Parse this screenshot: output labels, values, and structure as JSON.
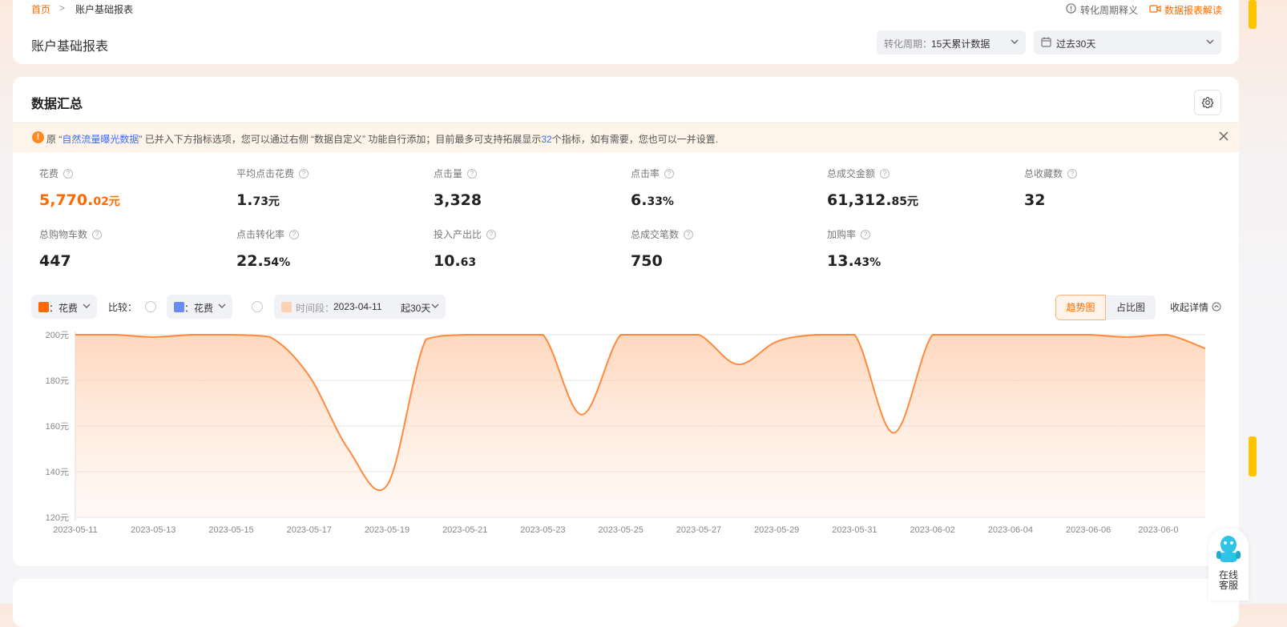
{
  "breadcrumb": {
    "home": "首页",
    "separator": ">",
    "current": "账户基础报表"
  },
  "page_title": "账户基础报表",
  "header_links": {
    "conversion_help": "转化周期释义",
    "report_guide": "数据报表解读"
  },
  "filters": {
    "conversion_period_label": "转化周期：",
    "conversion_period_value": "15天累计数据",
    "date_range_value": "过去30天"
  },
  "summary": {
    "title": "数据汇总",
    "notice": {
      "prefix": "原 “",
      "link": "自然流量曝光数据",
      "middle": "” 已并入下方指标选项，您可以通过右侧 “数据自定义” 功能自行添加；目前最多可支持拓展显示",
      "count": "32",
      "suffix": "个指标，如有需要，您也可以一并设置."
    },
    "metrics": [
      {
        "label": "花费",
        "main": "5,770.",
        "small": "02元"
      },
      {
        "label": "平均点击花费",
        "main": "1.",
        "small": "73元"
      },
      {
        "label": "点击量",
        "main": "3,328",
        "small": ""
      },
      {
        "label": "点击率",
        "main": "6.",
        "small": "33%"
      },
      {
        "label": "总成交金额",
        "main": "61,312.",
        "small": "85元"
      },
      {
        "label": "总收藏数",
        "main": "32",
        "small": ""
      },
      {
        "label": "总购物车数",
        "main": "447",
        "small": ""
      },
      {
        "label": "点击转化率",
        "main": "22.",
        "small": "54%"
      },
      {
        "label": "投入产出比",
        "main": "10.",
        "small": "63"
      },
      {
        "label": "总成交笔数",
        "main": "750",
        "small": ""
      },
      {
        "label": "加购率",
        "main": "13.",
        "small": "43%"
      }
    ]
  },
  "chart_controls": {
    "metric_a": "：花费",
    "compare_label": "比较：",
    "metric_b": "：花费",
    "period_label": "时间段：",
    "period_date": "2023-04-11",
    "period_suffix": "起30天",
    "trend_tab": "趋势图",
    "ratio_tab": "占比图",
    "collapse": "收起详情"
  },
  "colors": {
    "accent": "#ff6a00",
    "line": "#ff8a3d",
    "compare": "#6b8cf7",
    "period": "#ffd2b3"
  },
  "chart_data": {
    "type": "area",
    "series": [
      {
        "name": "花费"
      }
    ],
    "x": [
      "2023-05-11",
      "2023-05-12",
      "2023-05-13",
      "2023-05-14",
      "2023-05-15",
      "2023-05-16",
      "2023-05-17",
      "2023-05-18",
      "2023-05-19",
      "2023-05-20",
      "2023-05-21",
      "2023-05-22",
      "2023-05-23",
      "2023-05-24",
      "2023-05-25",
      "2023-05-26",
      "2023-05-27",
      "2023-05-28",
      "2023-05-29",
      "2023-05-30",
      "2023-05-31",
      "2023-06-01",
      "2023-06-02",
      "2023-06-03",
      "2023-06-04",
      "2023-06-05",
      "2023-06-06",
      "2023-06-07",
      "2023-06-08",
      "2023-06-09"
    ],
    "values": [
      200,
      200,
      199,
      200,
      200,
      199,
      182,
      150,
      134,
      198,
      200,
      200,
      200,
      165,
      200,
      200,
      200,
      187,
      197,
      200,
      200,
      157,
      200,
      200,
      200,
      200,
      200,
      199,
      200,
      194
    ],
    "x_tick_labels": [
      "2023-05-11",
      "2023-05-13",
      "2023-05-15",
      "2023-05-17",
      "2023-05-19",
      "2023-05-21",
      "2023-05-23",
      "2023-05-25",
      "2023-05-27",
      "2023-05-29",
      "2023-05-31",
      "2023-06-02",
      "2023-06-04",
      "2023-06-06",
      "2023-06-0"
    ],
    "y_ticks": [
      120,
      140,
      160,
      180,
      200
    ],
    "y_tick_labels": [
      "120元",
      "140元",
      "160元",
      "180元",
      "200元"
    ],
    "ylim": [
      120,
      200
    ],
    "grid": true
  },
  "service": {
    "line1": "在线",
    "line2": "客服"
  }
}
